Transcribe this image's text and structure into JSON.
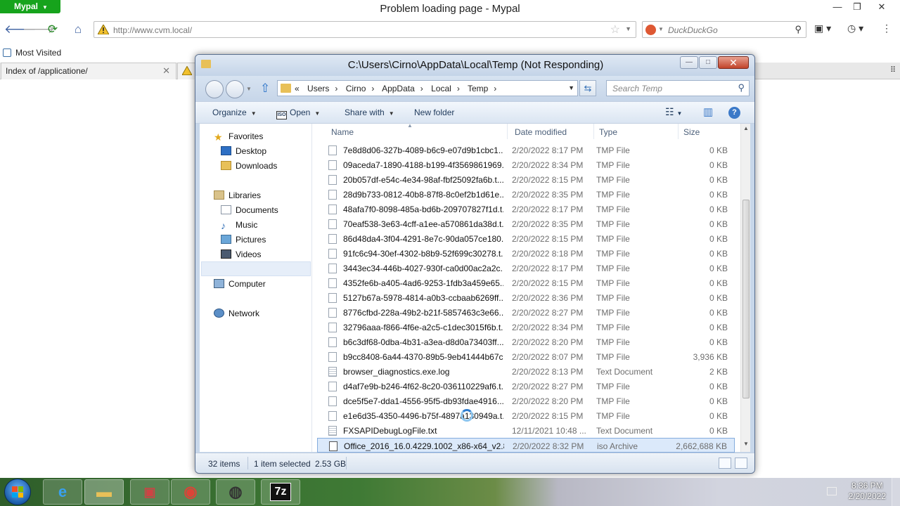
{
  "browser": {
    "app_menu": "Mypal",
    "window_title": "Problem loading page - Mypal",
    "url": "http://www.cvm.local/",
    "search_placeholder": "DuckDuckGo",
    "bookmark": "Most Visited",
    "tabs": [
      {
        "label": "Index of /applicatione/"
      }
    ]
  },
  "explorer": {
    "title": "C:\\Users\\Cirno\\AppData\\Local\\Temp (Not Responding)",
    "breadcrumb_prefix": "«",
    "breadcrumbs": [
      "Users",
      "Cirno",
      "AppData",
      "Local",
      "Temp"
    ],
    "search_placeholder": "Search Temp",
    "toolbar": {
      "organize": "Organize",
      "open": "Open",
      "share_with": "Share with",
      "new_folder": "New folder"
    },
    "nav": {
      "favorites": "Favorites",
      "desktop": "Desktop",
      "downloads": "Downloads",
      "libraries": "Libraries",
      "documents": "Documents",
      "music": "Music",
      "pictures": "Pictures",
      "videos": "Videos",
      "computer": "Computer",
      "network": "Network"
    },
    "columns": {
      "name": "Name",
      "date": "Date modified",
      "type": "Type",
      "size": "Size"
    },
    "files": [
      {
        "name": "7e8d8d06-327b-4089-b6c9-e07d9b1cbc1...",
        "date": "2/20/2022 8:17 PM",
        "type": "TMP File",
        "size": "0 KB",
        "icon": "blank"
      },
      {
        "name": "09aceda7-1890-4188-b199-4f3569861969...",
        "date": "2/20/2022 8:34 PM",
        "type": "TMP File",
        "size": "0 KB",
        "icon": "blank"
      },
      {
        "name": "20b057df-e54c-4e34-98af-fbf25092fa6b.t...",
        "date": "2/20/2022 8:15 PM",
        "type": "TMP File",
        "size": "0 KB",
        "icon": "blank"
      },
      {
        "name": "28d9b733-0812-40b8-87f8-8c0ef2b1d61e...",
        "date": "2/20/2022 8:35 PM",
        "type": "TMP File",
        "size": "0 KB",
        "icon": "blank"
      },
      {
        "name": "48afa7f0-8098-485a-bd6b-209707827f1d.t...",
        "date": "2/20/2022 8:17 PM",
        "type": "TMP File",
        "size": "0 KB",
        "icon": "blank"
      },
      {
        "name": "70eaf538-3e63-4cff-a1ee-a570861da38d.t...",
        "date": "2/20/2022 8:35 PM",
        "type": "TMP File",
        "size": "0 KB",
        "icon": "blank"
      },
      {
        "name": "86d48da4-3f04-4291-8e7c-90da057ce180....",
        "date": "2/20/2022 8:15 PM",
        "type": "TMP File",
        "size": "0 KB",
        "icon": "blank"
      },
      {
        "name": "91fc6c94-30ef-4302-b8b9-52f699c30278.t...",
        "date": "2/20/2022 8:18 PM",
        "type": "TMP File",
        "size": "0 KB",
        "icon": "blank"
      },
      {
        "name": "3443ec34-446b-4027-930f-ca0d00ac2a2c....",
        "date": "2/20/2022 8:17 PM",
        "type": "TMP File",
        "size": "0 KB",
        "icon": "blank"
      },
      {
        "name": "4352fe6b-a405-4ad6-9253-1fdb3a459e65....",
        "date": "2/20/2022 8:15 PM",
        "type": "TMP File",
        "size": "0 KB",
        "icon": "blank"
      },
      {
        "name": "5127b67a-5978-4814-a0b3-ccbaab6269ff....",
        "date": "2/20/2022 8:36 PM",
        "type": "TMP File",
        "size": "0 KB",
        "icon": "blank"
      },
      {
        "name": "8776cfbd-228a-49b2-b21f-5857463c3e66....",
        "date": "2/20/2022 8:27 PM",
        "type": "TMP File",
        "size": "0 KB",
        "icon": "blank"
      },
      {
        "name": "32796aaa-f866-4f6e-a2c5-c1dec3015f6b.t...",
        "date": "2/20/2022 8:34 PM",
        "type": "TMP File",
        "size": "0 KB",
        "icon": "blank"
      },
      {
        "name": "b6c3df68-0dba-4b31-a3ea-d8d0a73403ff....",
        "date": "2/20/2022 8:20 PM",
        "type": "TMP File",
        "size": "0 KB",
        "icon": "blank"
      },
      {
        "name": "b9cc8408-6a44-4370-89b5-9eb41444b67c...",
        "date": "2/20/2022 8:07 PM",
        "type": "TMP File",
        "size": "3,936 KB",
        "icon": "blank"
      },
      {
        "name": "browser_diagnostics.exe.log",
        "date": "2/20/2022 8:13 PM",
        "type": "Text Document",
        "size": "2 KB",
        "icon": "text"
      },
      {
        "name": "d4af7e9b-b246-4f62-8c20-036110229af6.t...",
        "date": "2/20/2022 8:27 PM",
        "type": "TMP File",
        "size": "0 KB",
        "icon": "blank"
      },
      {
        "name": "dce5f5e7-dda1-4556-95f5-db93fdae4916....",
        "date": "2/20/2022 8:20 PM",
        "type": "TMP File",
        "size": "0 KB",
        "icon": "blank"
      },
      {
        "name": "e1e6d35-4350-4496-b75f-4897a130949a.t...",
        "date": "2/20/2022 8:15 PM",
        "type": "TMP File",
        "size": "0 KB",
        "icon": "blank"
      },
      {
        "name": "FXSAPIDebugLogFile.txt",
        "date": "12/11/2021 10:48 ...",
        "type": "Text Document",
        "size": "0 KB",
        "icon": "text"
      },
      {
        "name": "Office_2016_16.0.4229.1002_x86-x64_v2.8.i...",
        "date": "2/20/2022 8:32 PM",
        "type": "iso Archive",
        "size": "2,662,688 KB",
        "icon": "iso",
        "selected": true
      }
    ],
    "status": {
      "count": "32 items",
      "selection": "1 item selected",
      "size": "2.53 GB"
    }
  },
  "taskbar": {
    "time": "8:36 PM",
    "date": "2/20/2022",
    "apps": [
      "internet-explorer",
      "file-explorer",
      "installer",
      "chrome",
      "raccoon-app",
      "7zip"
    ],
    "seven_zip_label": "7z"
  },
  "colors": {
    "mypal_green": "#16a31c",
    "close_red": "#c1432a",
    "selection_blue": "#dbe9fa"
  }
}
